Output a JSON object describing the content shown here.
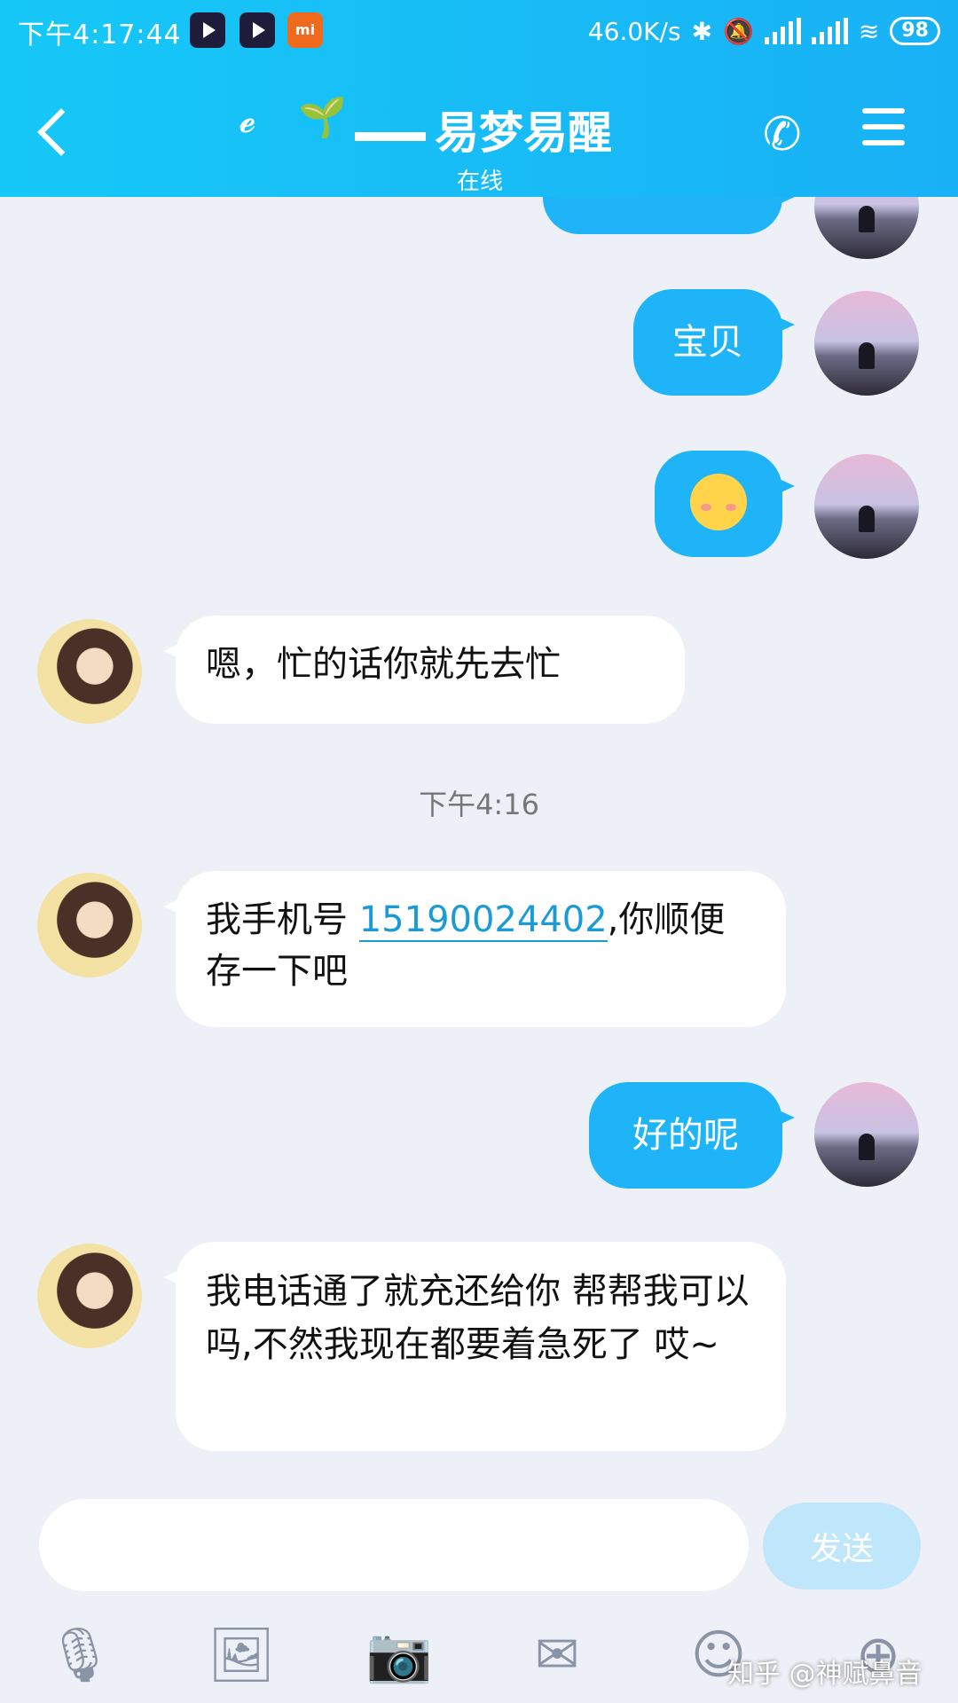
{
  "status_bar": {
    "time": "下午4:17:44",
    "net_speed": "46.0K/s",
    "battery": "98"
  },
  "header": {
    "title": "易梦易醒",
    "online_status": "在线"
  },
  "messages": [
    {
      "from": "me",
      "text": "宝贝"
    },
    {
      "from": "me",
      "emoji": "blush-emoji"
    },
    {
      "from": "her",
      "text": "嗯，忙的话你就先去忙"
    },
    {
      "time": "下午4:16"
    },
    {
      "from": "her",
      "text_before": "我手机号",
      "phone": "15190024402",
      "text_after": ",你顺便存一下吧"
    },
    {
      "from": "me",
      "text": "好的呢"
    },
    {
      "from": "her",
      "text": "我电话通了就充还给你 帮帮我可以吗,不然我现在都要着急死了 哎~"
    }
  ],
  "input": {
    "placeholder": "",
    "send_label": "发送"
  },
  "watermark": "知乎 @神赋鼻音",
  "colors": {
    "header_gradient_start": "#16c8f7",
    "header_gradient_end": "#19b1f6",
    "bubble_out": "#1eb4f7",
    "bubble_in": "#ffffff",
    "background": "#edf0f7",
    "phone_link": "#1a9bd8"
  }
}
